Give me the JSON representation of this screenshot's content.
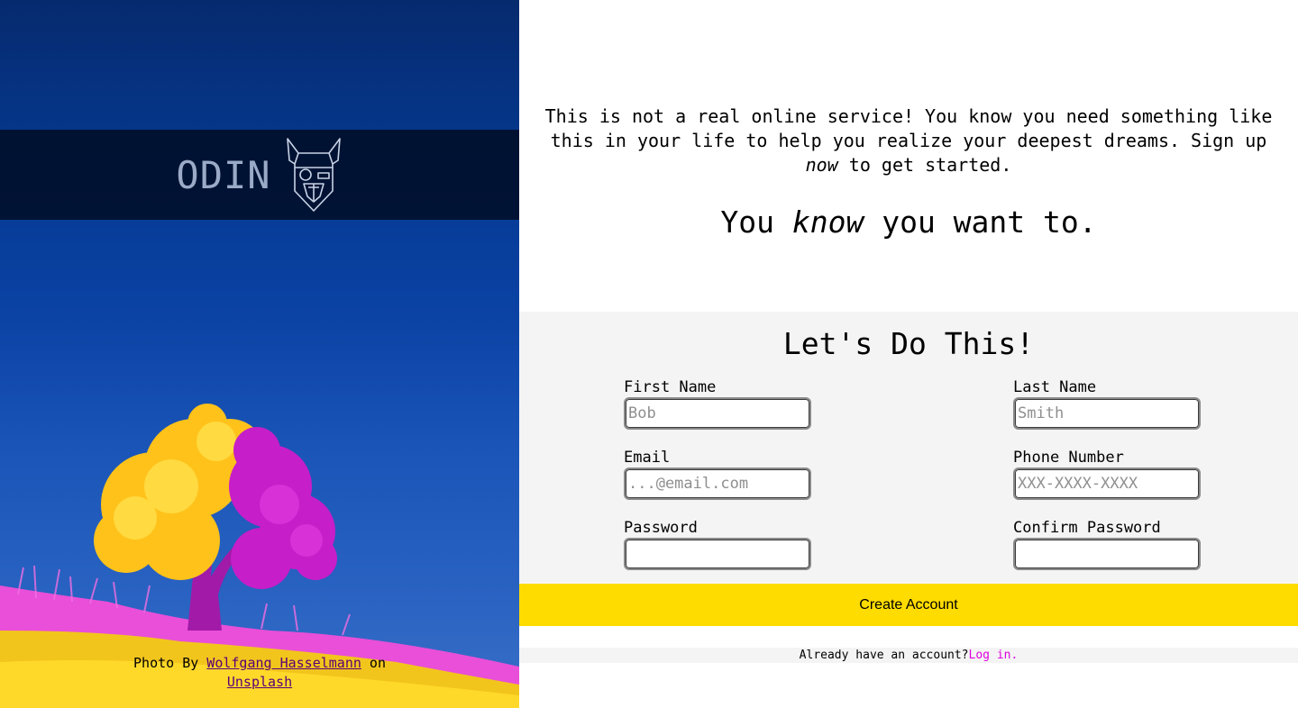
{
  "brand": {
    "logo_text": "ODIN"
  },
  "photo_credit": {
    "prefix": "Photo By ",
    "author": "Wolfgang Hasselmann",
    "middle": " on ",
    "site": "Unsplash"
  },
  "intro": {
    "text_before": "This is not a real online service! You know you need something like this in your life to help you realize your deepest dreams. Sign up ",
    "emphasis": "now",
    "text_after": " to get started."
  },
  "tagline": {
    "before": "You ",
    "emphasis": "know",
    "after": " you want to."
  },
  "form": {
    "title": "Let's Do This!",
    "fields": [
      {
        "label": "First Name",
        "placeholder": "Bob",
        "value": ""
      },
      {
        "label": "Last Name",
        "placeholder": "Smith",
        "value": ""
      },
      {
        "label": "Email",
        "placeholder": "...@email.com",
        "value": ""
      },
      {
        "label": "Phone Number",
        "placeholder": "XXX-XXXX-XXXX",
        "value": ""
      },
      {
        "label": "Password",
        "placeholder": "",
        "value": ""
      },
      {
        "label": "Confirm Password",
        "placeholder": "",
        "value": ""
      }
    ],
    "submit_label": "Create Account"
  },
  "login": {
    "prompt": "Already have an account?",
    "link_label": "Log in."
  },
  "colors": {
    "accent_yellow": "#ffdc00",
    "link_magenta": "#e000e0",
    "form_bg": "#f4f4f4"
  }
}
